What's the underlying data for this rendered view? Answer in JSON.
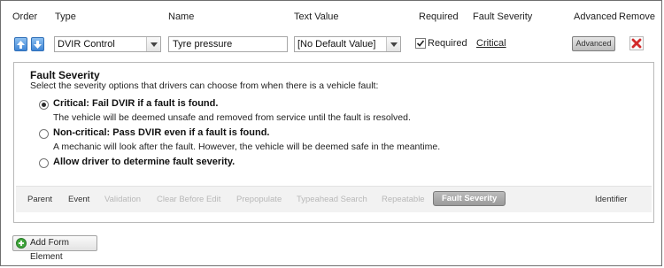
{
  "headers": {
    "order": "Order",
    "type": "Type",
    "name": "Name",
    "text_value": "Text Value",
    "required": "Required",
    "fault_severity": "Fault Severity",
    "advanced": "Advanced",
    "remove": "Remove"
  },
  "row": {
    "type_value": "DVIR Control",
    "name_value": "Tyre pressure",
    "text_value_selected": "[No Default Value]",
    "required_checked": true,
    "required_label": "Required",
    "fault_severity_link": "Critical",
    "advanced_button": "Advanced"
  },
  "panel": {
    "title": "Fault Severity",
    "description": "Select the severity options that drivers can choose from when there is a vehicle fault:",
    "options": [
      {
        "label": "Critical: Fail DVIR if a fault is found.",
        "description": "The vehicle will be deemed unsafe and removed from service until the fault is resolved.",
        "selected": true
      },
      {
        "label": "Non-critical: Pass DVIR even if a fault is found.",
        "description": "A mechanic will look after the fault. However, the vehicle will be deemed safe in the meantime.",
        "selected": false
      },
      {
        "label": "Allow driver to determine fault severity.",
        "description": "",
        "selected": false
      }
    ],
    "tabs": [
      {
        "label": "Parent",
        "state": "enabled"
      },
      {
        "label": "Event",
        "state": "enabled"
      },
      {
        "label": "Validation",
        "state": "disabled"
      },
      {
        "label": "Clear Before Edit",
        "state": "disabled"
      },
      {
        "label": "Prepopulate",
        "state": "disabled"
      },
      {
        "label": "Typeahead Search",
        "state": "disabled"
      },
      {
        "label": "Repeatable",
        "state": "disabled"
      },
      {
        "label": "Fault Severity",
        "state": "active"
      },
      {
        "label": "Identifier",
        "state": "enabled"
      }
    ]
  },
  "footer": {
    "add_button": "Add Form Element"
  },
  "colors": {
    "arrow_blue": "#3f86d6",
    "remove_red": "#d22a2a",
    "add_green": "#3ea53a",
    "active_tab": "#a8a8a8"
  },
  "icons": {
    "move_up": "arrow-up-icon",
    "move_down": "arrow-down-icon",
    "remove": "x-icon",
    "add": "plus-circle-icon",
    "dropdown": "chevron-down-icon"
  }
}
